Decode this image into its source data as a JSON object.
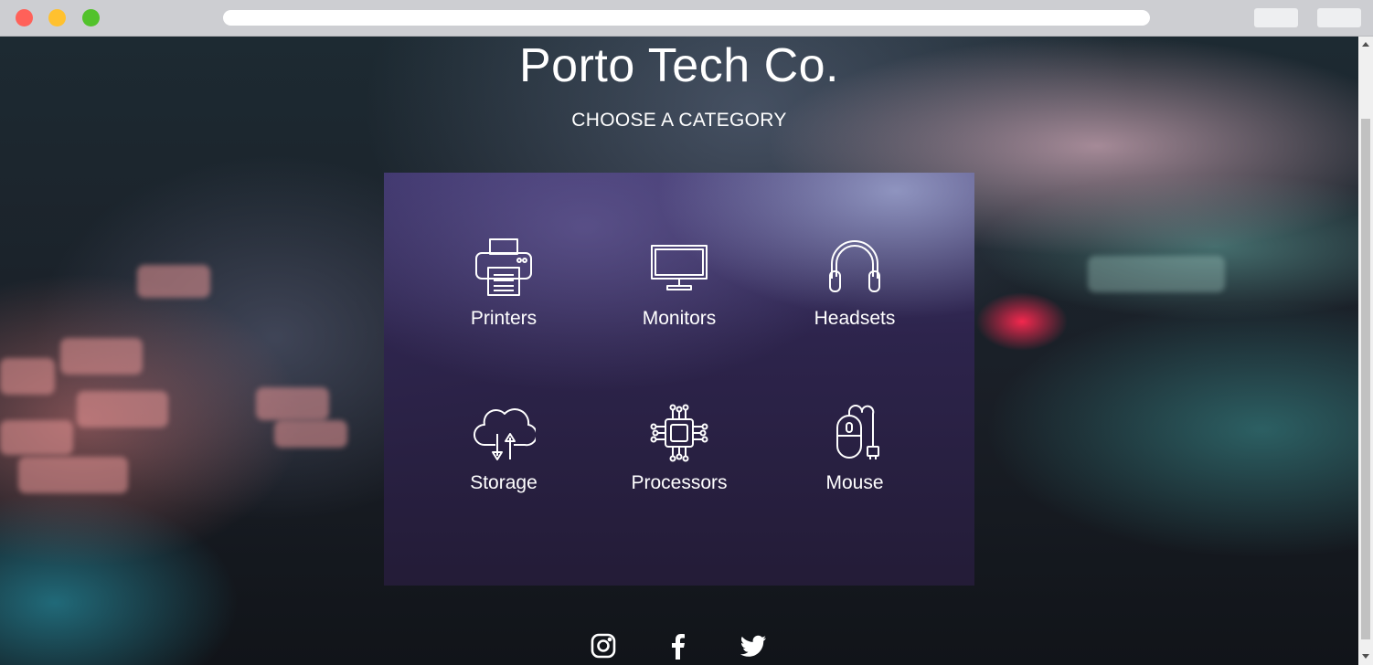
{
  "page": {
    "title": "Porto Tech Co.",
    "subtitle": "CHOOSE A CATEGORY"
  },
  "categories": [
    {
      "label": "Printers",
      "icon": "printer-icon"
    },
    {
      "label": "Monitors",
      "icon": "monitor-icon"
    },
    {
      "label": "Headsets",
      "icon": "headset-icon"
    },
    {
      "label": "Storage",
      "icon": "cloud-storage-icon"
    },
    {
      "label": "Processors",
      "icon": "processor-icon"
    },
    {
      "label": "Mouse",
      "icon": "mouse-icon"
    }
  ],
  "social": [
    {
      "icon": "instagram-icon"
    },
    {
      "icon": "facebook-icon"
    },
    {
      "icon": "twitter-icon"
    }
  ],
  "colors": {
    "text": "#ffffff",
    "panel": "#2e244e",
    "accent_red": "#ff2850"
  }
}
